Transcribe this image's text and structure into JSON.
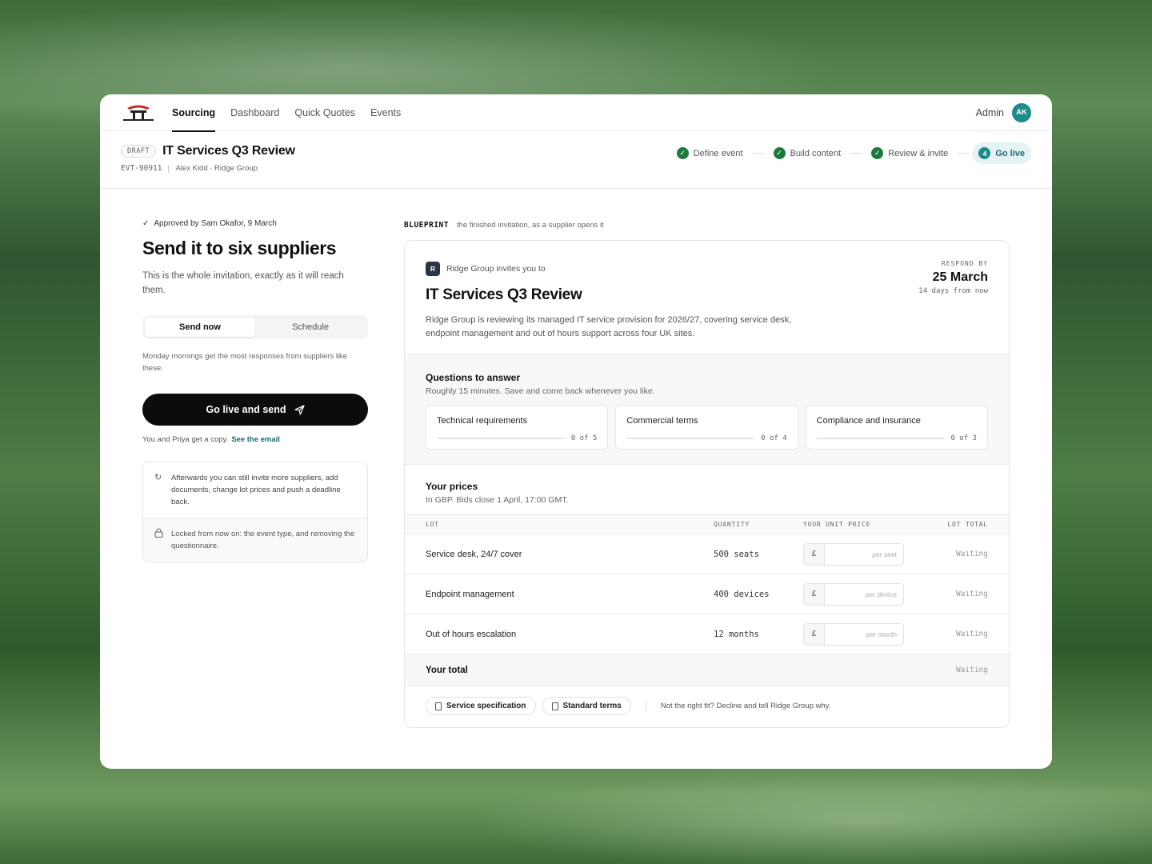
{
  "nav": {
    "tabs": [
      {
        "label": "Sourcing",
        "active": true
      },
      {
        "label": "Dashboard"
      },
      {
        "label": "Quick Quotes"
      },
      {
        "label": "Events"
      }
    ],
    "user_label": "Admin",
    "avatar_initials": "AK",
    "avatar_color": "#1f8a8a"
  },
  "header": {
    "status_badge": "DRAFT",
    "title": "IT Services Q3 Review",
    "event_id": "EVT-90911",
    "owner": "Alex Kidd · Ridge Group",
    "steps": [
      {
        "label": "Define event",
        "done": true
      },
      {
        "label": "Build content",
        "done": true
      },
      {
        "label": "Review & invite",
        "done": true
      },
      {
        "label": "Go live",
        "number": "4",
        "current": true
      }
    ]
  },
  "left": {
    "approved_text": "Approved by Sam Okafor, 9 March",
    "heading": "Send it to six suppliers",
    "subtitle": "This is the whole invitation, exactly as it will reach them.",
    "segment": {
      "send_now": "Send now",
      "schedule": "Schedule",
      "selected": "send_now"
    },
    "hint": "Monday mornings get the most responses from suppliers like these.",
    "primary_button": "Go live and send",
    "copy_text": "You and Priya get a copy.",
    "copy_link": "See the email",
    "note_after": "Afterwards you can still invite more suppliers, add documents, change lot prices and push a deadline back.",
    "note_locked": "Locked from now on: the event type, and removing the questionnaire."
  },
  "blueprint": {
    "tag": "BLUEPRINT",
    "caption": "the finished invitation, as a supplier opens it"
  },
  "invitation": {
    "org_initial": "R",
    "invite_line": "Ridge Group invites you to",
    "title": "IT Services Q3 Review",
    "description": "Ridge Group is reviewing its managed IT service provision for 2026/27, covering service desk, endpoint management and out of hours support across four UK sites.",
    "respond_label": "RESPOND BY",
    "respond_date": "25 March",
    "respond_relative": "14 days from now",
    "questions": {
      "heading": "Questions to answer",
      "subtitle": "Roughly 15 minutes. Save and come back whenever you like.",
      "sections": [
        {
          "name": "Technical requirements",
          "progress": "0 of 5",
          "answered": 0,
          "total": 5
        },
        {
          "name": "Commercial terms",
          "progress": "0 of 4",
          "answered": 0,
          "total": 4
        },
        {
          "name": "Compliance and insurance",
          "progress": "0 of 3",
          "answered": 0,
          "total": 3
        }
      ]
    },
    "prices": {
      "heading": "Your prices",
      "subtitle": "In GBP. Bids close 1 April, 17:00 GMT.",
      "columns": {
        "lot": "LOT",
        "quantity": "QUANTITY",
        "unit_price": "YOUR UNIT PRICE",
        "total": "LOT TOTAL"
      },
      "currency_symbol": "£",
      "lots": [
        {
          "name": "Service desk, 24/7 cover",
          "quantity": "500 seats",
          "placeholder": "per seat",
          "total": "Waiting"
        },
        {
          "name": "Endpoint management",
          "quantity": "400 devices",
          "placeholder": "per device",
          "total": "Waiting"
        },
        {
          "name": "Out of hours escalation",
          "quantity": "12 months",
          "placeholder": "per month",
          "total": "Waiting"
        }
      ],
      "total_label": "Your total",
      "total_value": "Waiting"
    },
    "attachments": [
      {
        "label": "Service specification"
      },
      {
        "label": "Standard terms"
      }
    ],
    "decline_text": "Not the right fit? Decline and tell Ridge Group why."
  }
}
